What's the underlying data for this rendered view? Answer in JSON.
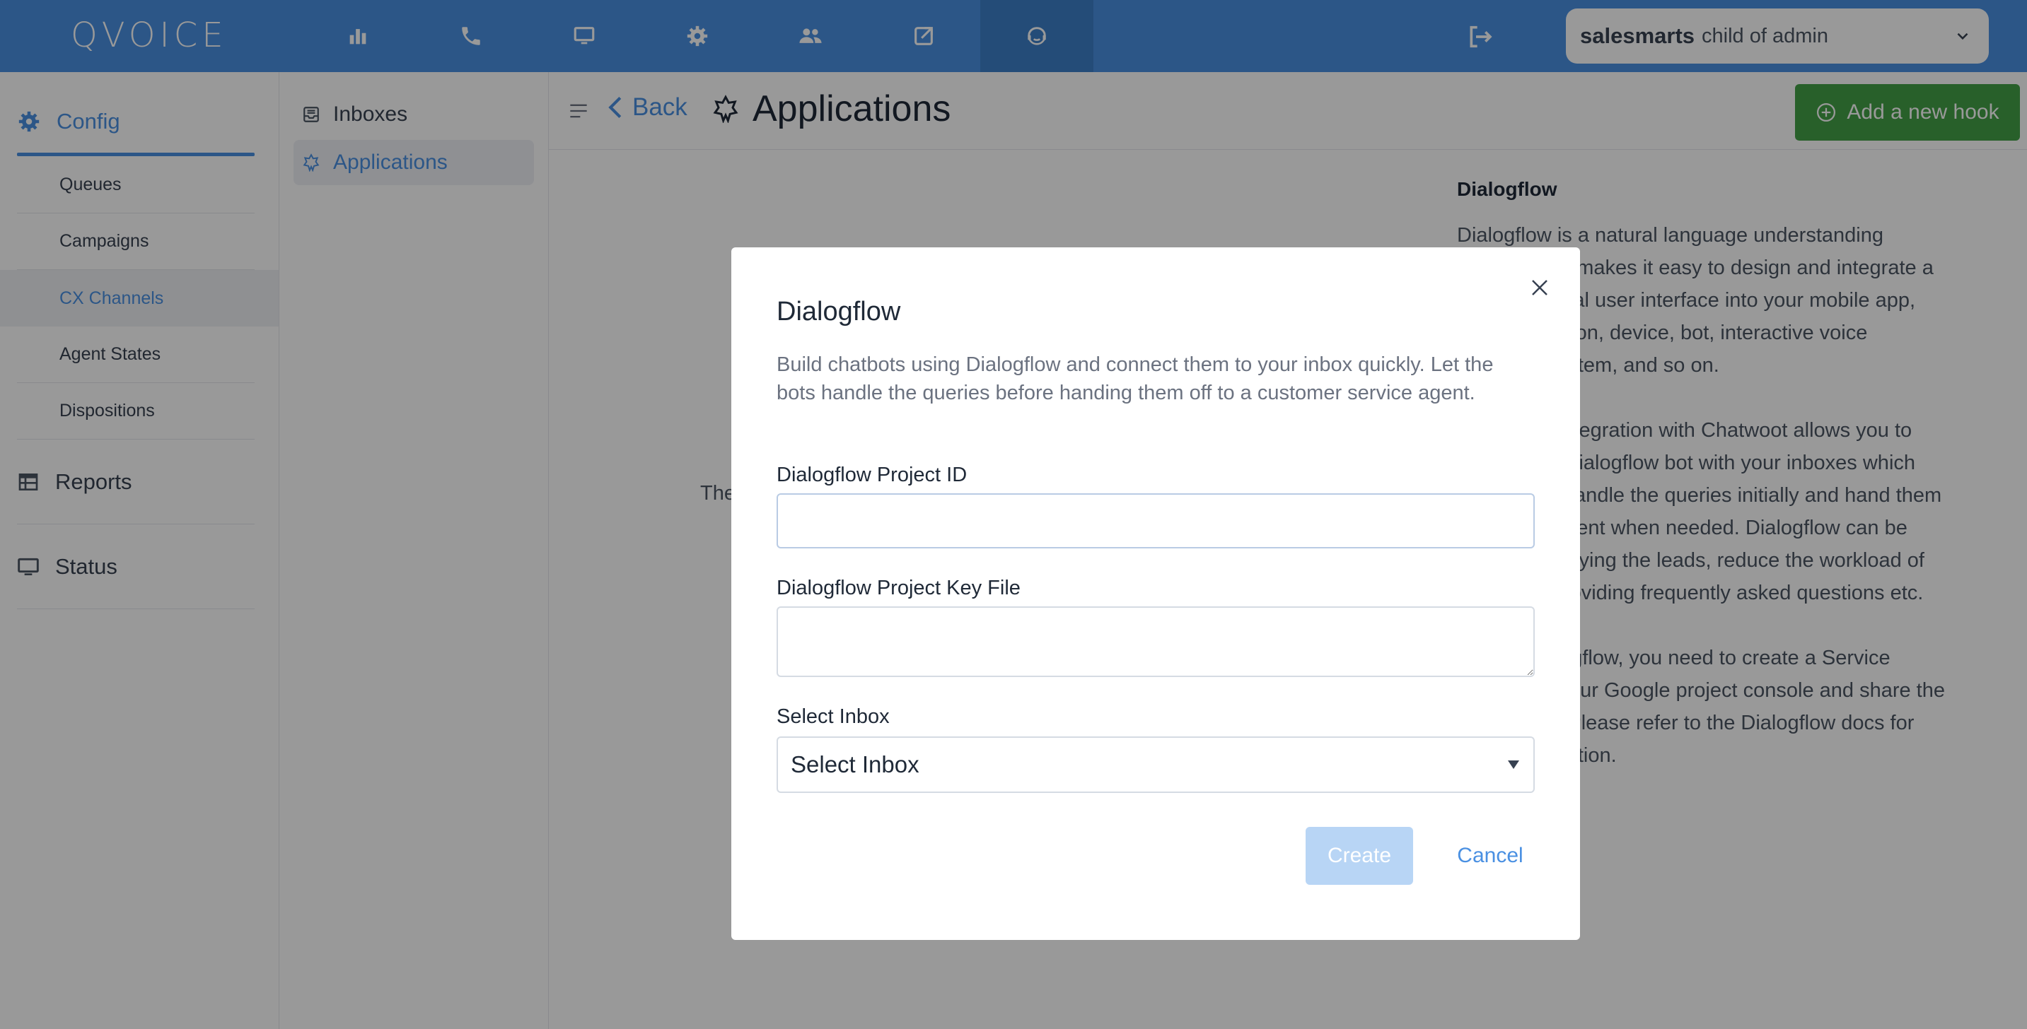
{
  "app": {
    "logo": "QVOICE",
    "brand_color": "#4a90e2"
  },
  "topnav": {
    "items": [
      {
        "icon": "bar-chart-icon"
      },
      {
        "icon": "phone-icon"
      },
      {
        "icon": "monitor-icon"
      },
      {
        "icon": "gear-icon"
      },
      {
        "icon": "users-icon"
      },
      {
        "icon": "external-link-icon"
      },
      {
        "icon": "headset-agent-icon",
        "active": true
      }
    ],
    "logout_icon": "logout-icon",
    "account": {
      "name": "salesmarts",
      "subtitle": "child of admin"
    }
  },
  "sidebar": {
    "config_label": "Config",
    "subitems": [
      "Queues",
      "Campaigns",
      "CX Channels",
      "Agent States",
      "Dispositions"
    ],
    "active_subitem": "CX Channels",
    "reports_label": "Reports",
    "status_label": "Status"
  },
  "secondary_sidebar": {
    "items": [
      {
        "label": "Inboxes",
        "icon": "inbox-icon"
      },
      {
        "label": "Applications",
        "icon": "integration-icon",
        "active": true
      }
    ]
  },
  "header": {
    "back_label": "Back",
    "title": "Applications",
    "add_hook_label": "Add a new hook",
    "add_hook_color": "#44a047"
  },
  "main": {
    "empty_text_fragment": "The"
  },
  "info_panel": {
    "title": "Dialogflow",
    "paragraphs": [
      "Dialogflow is a natural language understanding platform that makes it easy to design and integrate a conversational user interface into your mobile app, web application, device, bot, interactive voice response system, and so on.",
      "Dialogflow integration with Chatwoot allows you to configure a Dialogflow bot with your inboxes which lets the bot handle the queries initially and hand them over to an agent when needed. Dialogflow can be used to qualifying the leads, reduce the workload of agents by providing frequently asked questions etc.",
      "To add Dialogflow, you need to create a Service Account in your Google project console and share the credentials. Please refer to the Dialogflow docs for more information."
    ]
  },
  "modal": {
    "title": "Dialogflow",
    "description": "Build chatbots using Dialogflow and connect them to your inbox quickly. Let the bots handle the queries before handing them off to a customer service agent.",
    "project_id_label": "Dialogflow Project ID",
    "project_id_value": "",
    "key_file_label": "Dialogflow Project Key File",
    "key_file_value": "",
    "inbox_label": "Select Inbox",
    "inbox_selected": "Select Inbox",
    "create_label": "Create",
    "cancel_label": "Cancel"
  }
}
